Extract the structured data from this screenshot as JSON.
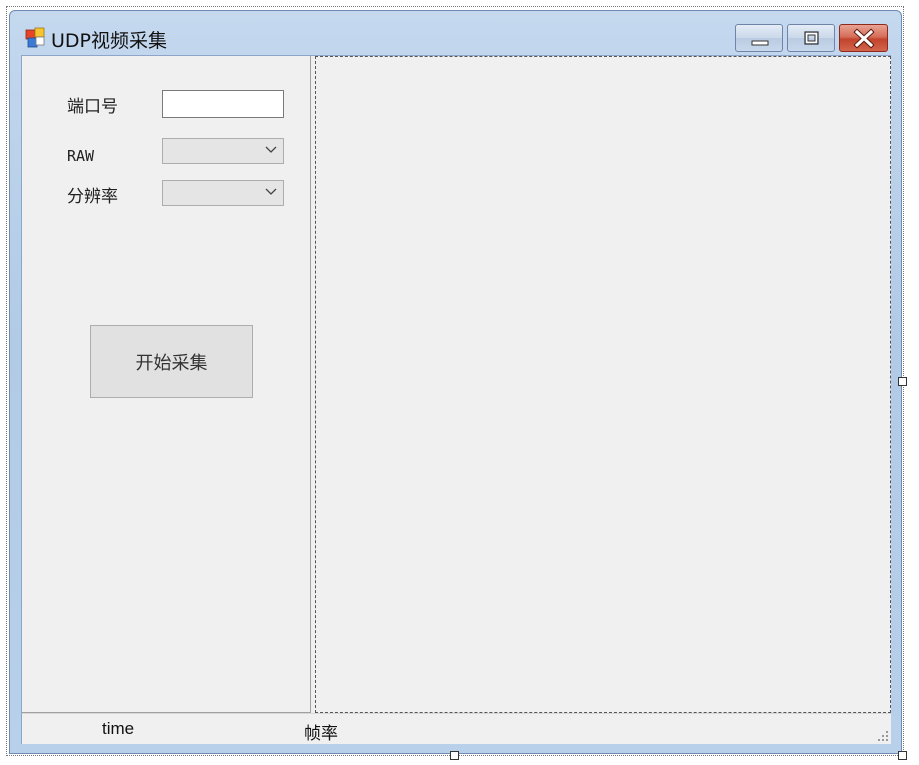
{
  "window": {
    "title": "UDP视频采集",
    "icon": "windows-form-icon",
    "caption_buttons": [
      "minimize-icon",
      "maximize-icon",
      "close-icon"
    ]
  },
  "form": {
    "port_label": "端口号",
    "port_value": "",
    "raw_label": "RAW",
    "raw_value": "",
    "resolution_label": "分辨率",
    "resolution_value": "",
    "start_button": "开始采集"
  },
  "statusbar": {
    "time": "time",
    "frame_rate": "帧率"
  },
  "colors": {
    "titlebar": "#b1cae6",
    "client_bg": "#f0f0f0",
    "close_button": "#c2442c",
    "button_bg": "#e1e1e1"
  }
}
